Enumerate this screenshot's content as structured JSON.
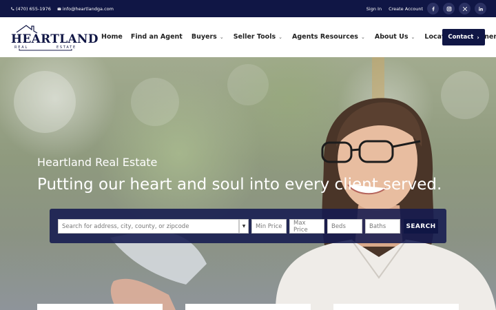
{
  "topbar": {
    "phone": "(470) 655-1976",
    "email": "info@heartlandga.com",
    "sign_in": "Sign In",
    "create_account": "Create Account",
    "socials": [
      "facebook-icon",
      "instagram-icon",
      "x-twitter-icon",
      "linkedin-icon"
    ]
  },
  "brand": {
    "name": "HEARTLAND",
    "sub_left": "REAL",
    "sub_right": "ESTATE",
    "color": "#101645"
  },
  "nav": {
    "items": [
      {
        "label": "Home",
        "dropdown": false
      },
      {
        "label": "Find an Agent",
        "dropdown": false
      },
      {
        "label": "Buyers",
        "dropdown": true
      },
      {
        "label": "Seller Tools",
        "dropdown": true
      },
      {
        "label": "Agents Resources",
        "dropdown": true
      },
      {
        "label": "About Us",
        "dropdown": true
      },
      {
        "label": "Locations",
        "dropdown": false
      },
      {
        "label": "Partners",
        "dropdown": false
      }
    ],
    "contact_label": "Contact"
  },
  "hero": {
    "eyebrow": "Heartland Real Estate",
    "headline": "Putting our heart and soul into every client served."
  },
  "search": {
    "address_placeholder": "Search for address, city, county, or zipcode",
    "min_price": "Min Price",
    "max_price": "Max Price",
    "beds": "Beds",
    "baths": "Baths",
    "button": "SEARCH"
  },
  "colors": {
    "navy": "#101645",
    "panel": "#141a50"
  }
}
